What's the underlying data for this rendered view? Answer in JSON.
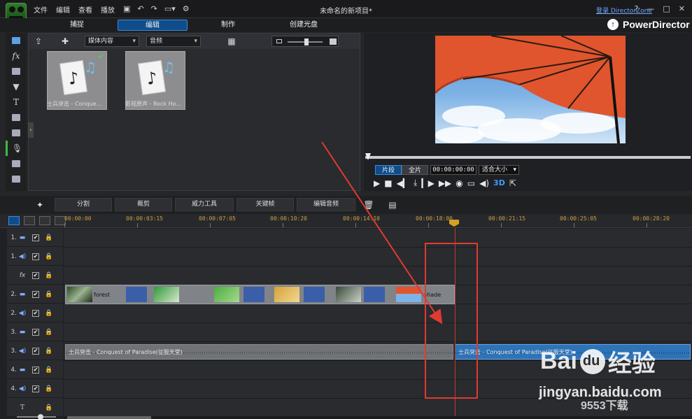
{
  "app": {
    "title": "未命名的新项目*",
    "menu": [
      "文件",
      "编辑",
      "查看",
      "播放"
    ],
    "director_zone_link": "登录 DirectorZone",
    "brand": "PowerDirector"
  },
  "mode_tabs": [
    {
      "label": "捕捉",
      "active": false
    },
    {
      "label": "编辑",
      "active": true
    },
    {
      "label": "制作",
      "active": false
    },
    {
      "label": "创建光盘",
      "active": false
    }
  ],
  "library": {
    "content_select": "媒体内容",
    "type_select": "音频",
    "items": [
      {
        "caption": "士兵突击 - Conque...",
        "in_use": true
      },
      {
        "caption": "影视原声 - Rock Ho...",
        "in_use": false
      }
    ]
  },
  "preview": {
    "tabs": [
      {
        "label": "片段",
        "active": true
      },
      {
        "label": "全片",
        "active": false
      }
    ],
    "timecode": "00:00:00:00",
    "fit_select": "适合大小",
    "threed_label": "3D"
  },
  "edit_toolbar": {
    "buttons": [
      "分割",
      "裁剪",
      "威力工具",
      "关键帧",
      "编辑音频"
    ]
  },
  "timeline": {
    "ruler_labels": [
      "00:00:00",
      "00:00:03:15",
      "00:00:07:05",
      "00:00:10:20",
      "00:00:14:10",
      "00:00:18:00",
      "00:00:21:15",
      "00:00:25:05",
      "00:00:28:20"
    ],
    "tracks": [
      {
        "num": "1.",
        "type": "video",
        "checked": true,
        "locked": true
      },
      {
        "num": "1.",
        "type": "audio",
        "checked": true,
        "locked": true
      },
      {
        "num": "",
        "type": "fx",
        "checked": true,
        "locked": true
      },
      {
        "num": "2.",
        "type": "video",
        "checked": true,
        "locked": true
      },
      {
        "num": "2.",
        "type": "audio",
        "checked": true,
        "locked": true
      },
      {
        "num": "3.",
        "type": "video",
        "checked": true,
        "locked": true
      },
      {
        "num": "3.",
        "type": "audio",
        "checked": true,
        "locked": true
      },
      {
        "num": "4.",
        "type": "video",
        "checked": true,
        "locked": true
      },
      {
        "num": "4.",
        "type": "audio",
        "checked": true,
        "locked": true
      },
      {
        "num": "",
        "type": "title",
        "checked": false,
        "locked": true
      }
    ],
    "video_clip_labels": [
      "forest",
      "shade"
    ],
    "audio_clips": [
      {
        "label": "士兵突击 - Conquest of Paradise(征服天堂)",
        "selected": false
      },
      {
        "label": "士兵突击 - Conquest of Paradise(征服天堂)",
        "selected": true
      }
    ]
  },
  "watermark": {
    "brand_left": "Bai",
    "brand_right": "经验",
    "site": "jingyan.baidu.com",
    "sub": "9553下载"
  },
  "colors": {
    "accent": "#0f4d8a",
    "highlight_box": "#e03a32",
    "playhead": "#c0392b",
    "selected_clip": "#2d73b8"
  }
}
